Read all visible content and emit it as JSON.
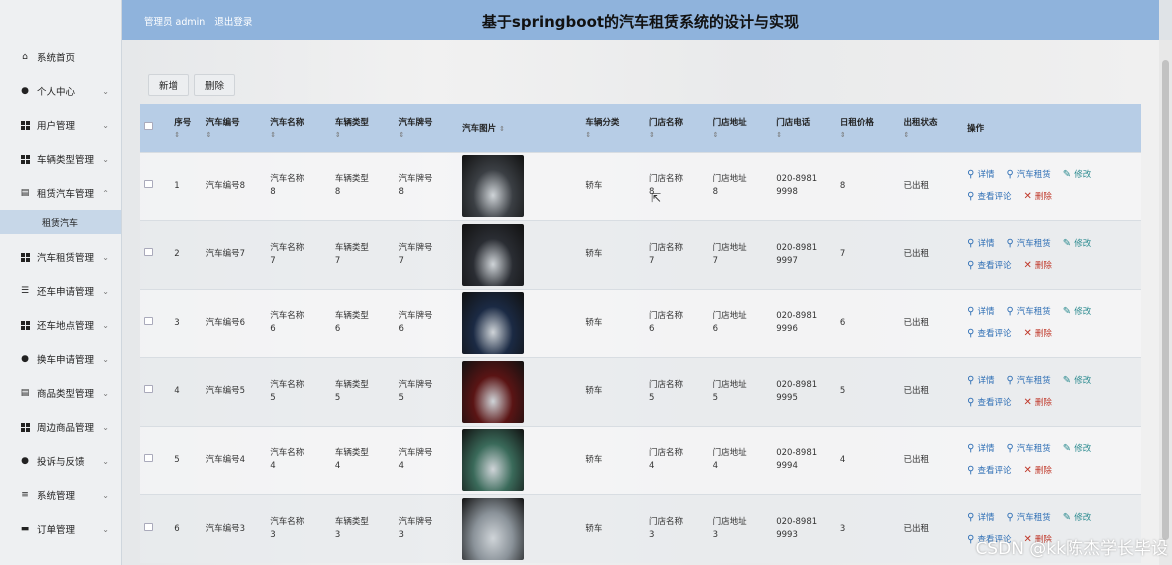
{
  "header": {
    "admin_label": "管理员 admin",
    "logout_label": "退出登录",
    "title": "基于springboot的汽车租赁系统的设计与实现"
  },
  "sidebar": {
    "items": [
      {
        "label": "系统首页",
        "icon": "home-icon",
        "chevron": ""
      },
      {
        "label": "个人中心",
        "icon": "user-icon",
        "chevron": "⌄"
      },
      {
        "label": "用户管理",
        "icon": "grid-icon",
        "chevron": "⌄"
      },
      {
        "label": "车辆类型管理",
        "icon": "grid-icon",
        "chevron": "⌄"
      },
      {
        "label": "租赁汽车管理",
        "icon": "doc-icon",
        "chevron": "⌃"
      },
      {
        "label": "汽车租赁管理",
        "icon": "grid-icon",
        "chevron": "⌄"
      },
      {
        "label": "还车申请管理",
        "icon": "sliders-icon",
        "chevron": "⌄"
      },
      {
        "label": "还车地点管理",
        "icon": "grid-icon",
        "chevron": "⌄"
      },
      {
        "label": "换车申请管理",
        "icon": "user-icon",
        "chevron": "⌄"
      },
      {
        "label": "商品类型管理",
        "icon": "doc-icon",
        "chevron": "⌄"
      },
      {
        "label": "周边商品管理",
        "icon": "grid-icon",
        "chevron": "⌄"
      },
      {
        "label": "投诉与反馈",
        "icon": "pin-icon",
        "chevron": "⌄"
      },
      {
        "label": "系统管理",
        "icon": "list-icon",
        "chevron": "⌄"
      },
      {
        "label": "订单管理",
        "icon": "printer-icon",
        "chevron": "⌄"
      }
    ],
    "submenu": {
      "label": "租赁汽车"
    }
  },
  "toolbar": {
    "add_label": "新增",
    "delete_label": "删除"
  },
  "table": {
    "headers": {
      "index": "序号",
      "car_no": "汽车编号",
      "car_name": "汽车名称",
      "car_type": "车辆类型",
      "plate": "汽车牌号",
      "image": "汽车图片",
      "category": "车辆分类",
      "store_name": "门店名称",
      "store_addr": "门店地址",
      "store_phone": "门店电话",
      "daily_price": "日租价格",
      "rent_status": "出租状态",
      "actions": "操作"
    },
    "sort_icon": "⇕",
    "actions": {
      "detail": "详情",
      "rent": "汽车租赁",
      "edit": "修改",
      "review": "查看评论",
      "delete": "删除"
    },
    "rows": [
      {
        "index": "1",
        "car_no": "汽车编号8",
        "name_a": "汽车名称",
        "name_b": "8",
        "type_a": "车辆类型",
        "type_b": "8",
        "plate_a": "汽车牌号",
        "plate_b": "8",
        "image_color": "#3b3f44",
        "category": "轿车",
        "store_a": "门店名称",
        "store_b": "8",
        "addr_a": "门店地址",
        "addr_b": "8",
        "phone_a": "020-8981",
        "phone_b": "9998",
        "price": "8",
        "status": "已出租"
      },
      {
        "index": "2",
        "car_no": "汽车编号7",
        "name_a": "汽车名称",
        "name_b": "7",
        "type_a": "车辆类型",
        "type_b": "7",
        "plate_a": "汽车牌号",
        "plate_b": "7",
        "image_color": "#2a2d33",
        "category": "轿车",
        "store_a": "门店名称",
        "store_b": "7",
        "addr_a": "门店地址",
        "addr_b": "7",
        "phone_a": "020-8981",
        "phone_b": "9997",
        "price": "7",
        "status": "已出租"
      },
      {
        "index": "3",
        "car_no": "汽车编号6",
        "name_a": "汽车名称",
        "name_b": "6",
        "type_a": "车辆类型",
        "type_b": "6",
        "plate_a": "汽车牌号",
        "plate_b": "6",
        "image_color": "#1b2a44",
        "category": "轿车",
        "store_a": "门店名称",
        "store_b": "6",
        "addr_a": "门店地址",
        "addr_b": "6",
        "phone_a": "020-8981",
        "phone_b": "9996",
        "price": "6",
        "status": "已出租"
      },
      {
        "index": "4",
        "car_no": "汽车编号5",
        "name_a": "汽车名称",
        "name_b": "5",
        "type_a": "车辆类型",
        "type_b": "5",
        "plate_a": "汽车牌号",
        "plate_b": "5",
        "image_color": "#5a1414",
        "category": "轿车",
        "store_a": "门店名称",
        "store_b": "5",
        "addr_a": "门店地址",
        "addr_b": "5",
        "phone_a": "020-8981",
        "phone_b": "9995",
        "price": "5",
        "status": "已出租"
      },
      {
        "index": "5",
        "car_no": "汽车编号4",
        "name_a": "汽车名称",
        "name_b": "4",
        "type_a": "车辆类型",
        "type_b": "4",
        "plate_a": "汽车牌号",
        "plate_b": "4",
        "image_color": "#3a6a5a",
        "category": "轿车",
        "store_a": "门店名称",
        "store_b": "4",
        "addr_a": "门店地址",
        "addr_b": "4",
        "phone_a": "020-8981",
        "phone_b": "9994",
        "price": "4",
        "status": "已出租"
      },
      {
        "index": "6",
        "car_no": "汽车编号3",
        "name_a": "汽车名称",
        "name_b": "3",
        "type_a": "车辆类型",
        "type_b": "3",
        "plate_a": "汽车牌号",
        "plate_b": "3",
        "image_color": "#8a9299",
        "category": "轿车",
        "store_a": "门店名称",
        "store_b": "3",
        "addr_a": "门店地址",
        "addr_b": "3",
        "phone_a": "020-8981",
        "phone_b": "9993",
        "price": "3",
        "status": "已出租"
      }
    ]
  },
  "watermark": "CSDN @kk陈杰学长毕设",
  "colors": {
    "header_bg": "#8fb3dc",
    "table_head_bg": "#b7cde6",
    "submenu_bg": "#c7d7e8",
    "link_blue": "#2f6fb5",
    "delete_red": "#c0392b"
  }
}
